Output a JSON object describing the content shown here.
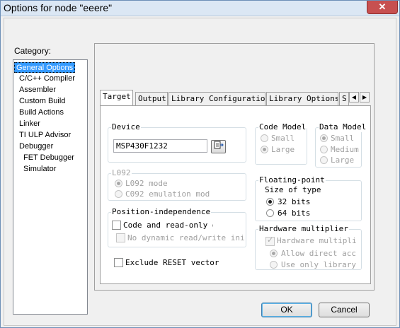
{
  "window": {
    "title": "Options for node \"eeere\"",
    "close": "✕"
  },
  "category": {
    "label": "Category:",
    "items": [
      "General Options",
      "C/C++ Compiler",
      "Assembler",
      "Custom Build",
      "Build Actions",
      "Linker",
      "TI ULP Advisor",
      "Debugger",
      "FET Debugger",
      "Simulator"
    ],
    "selected": "General Options"
  },
  "tabs": {
    "items": [
      "Target",
      "Output",
      "Library Configuration",
      "Library Options",
      "S"
    ],
    "active": "Target",
    "scroll_left": "◀",
    "scroll_right": "▶"
  },
  "device": {
    "label": "Device",
    "value": "MSP430F1232",
    "browse_icon": "browse-device-icon"
  },
  "code_model": {
    "label": "Code Model",
    "options": [
      "Small",
      "Large"
    ],
    "selected": "Large"
  },
  "data_model": {
    "label": "Data Model",
    "options": [
      "Small",
      "Medium",
      "Large"
    ],
    "selected": "Small"
  },
  "l092": {
    "label": "L092",
    "options": [
      "L092 mode",
      "C092 emulation mod"
    ],
    "selected": "L092 mode"
  },
  "floating_point": {
    "label": "Floating-point",
    "sublabel": "Size of type",
    "options": [
      "32 bits",
      "64 bits"
    ],
    "selected": "32 bits"
  },
  "position_independence": {
    "label": "Position-independence",
    "code_readonly": "Code and read-only da",
    "no_dynamic": "No dynamic read/write initi"
  },
  "hardware_multiplier": {
    "label": "Hardware multiplier",
    "checkbox": "Hardware multipli",
    "options": [
      "Allow direct acc",
      "Use only library"
    ],
    "selected": "Allow direct acc"
  },
  "exclude_reset": {
    "label": "Exclude RESET vector"
  },
  "buttons": {
    "ok": "OK",
    "cancel": "Cancel"
  }
}
